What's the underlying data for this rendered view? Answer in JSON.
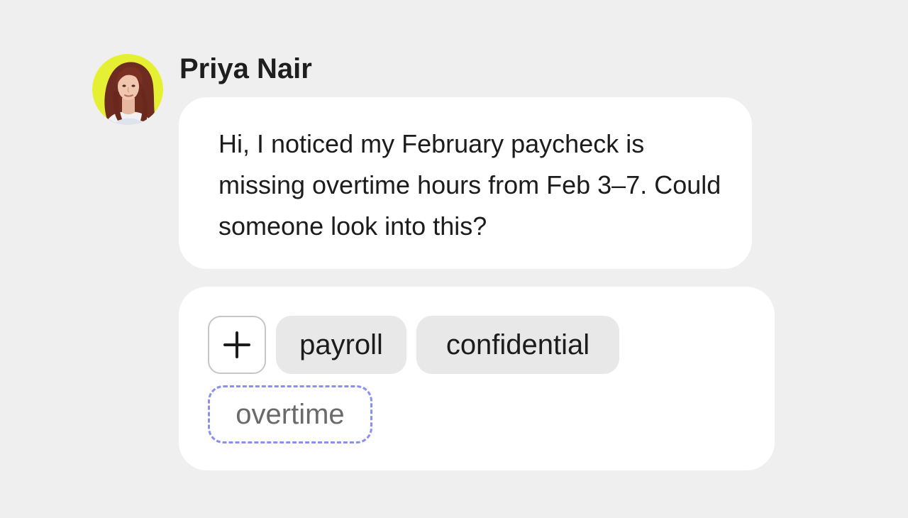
{
  "message": {
    "sender_name": "Priya Nair",
    "avatar": "user-photo-avatar",
    "text": "Hi, I noticed my February paycheck is missing overtime hours from Feb 3–7. Could someone look into this?"
  },
  "tags": {
    "add_icon": "plus-icon",
    "items": [
      {
        "label": "payroll"
      },
      {
        "label": "confidential"
      }
    ],
    "input_value": "overtime"
  },
  "colors": {
    "background": "#efefef",
    "card": "#ffffff",
    "chip": "#e8e8e8",
    "input_border": "#8b8ff0",
    "avatar_ring": "#e6f033"
  }
}
